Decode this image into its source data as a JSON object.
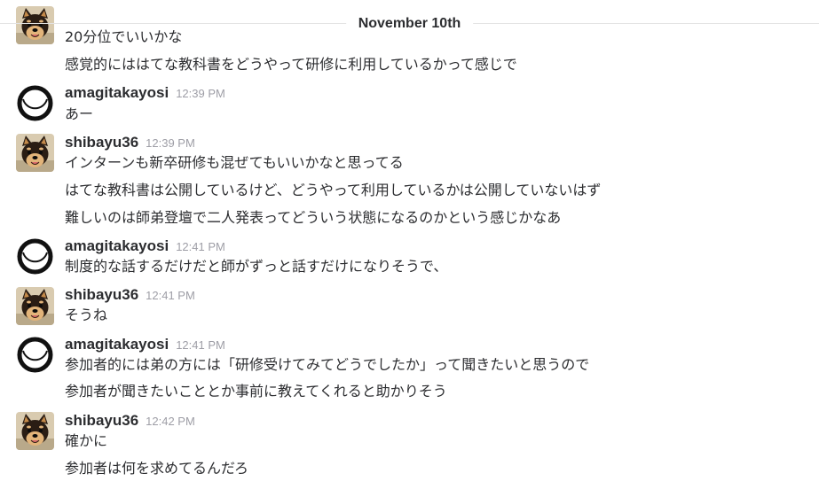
{
  "day_divider": {
    "label": "November 10th"
  },
  "messages": [
    {
      "sender": "",
      "time": "",
      "avatar": "shiba-avatar",
      "lines": [
        "20分位でいいかな",
        "感覚的にははてな教科書をどうやって研修に利用しているかって感じで"
      ]
    },
    {
      "sender": "amagitakayosi",
      "time": "12:39 PM",
      "avatar": "ring-avatar",
      "lines": [
        "あー"
      ]
    },
    {
      "sender": "shibayu36",
      "time": "12:39 PM",
      "avatar": "shiba-avatar",
      "lines": [
        "インターンも新卒研修も混ぜてもいいかなと思ってる",
        "はてな教科書は公開しているけど、どうやって利用しているかは公開していないはず",
        "難しいのは師弟登壇で二人発表ってどういう状態になるのかという感じかなあ"
      ]
    },
    {
      "sender": "amagitakayosi",
      "time": "12:41 PM",
      "avatar": "ring-avatar",
      "lines": [
        "制度的な話するだけだと師がずっと話すだけになりそうで、"
      ]
    },
    {
      "sender": "shibayu36",
      "time": "12:41 PM",
      "avatar": "shiba-avatar",
      "lines": [
        "そうね"
      ]
    },
    {
      "sender": "amagitakayosi",
      "time": "12:41 PM",
      "avatar": "ring-avatar",
      "lines": [
        "参加者的には弟の方には「研修受けてみてどうでしたか」って聞きたいと思うので",
        "参加者が聞きたいこととか事前に教えてくれると助かりそう"
      ]
    },
    {
      "sender": "shibayu36",
      "time": "12:42 PM",
      "avatar": "shiba-avatar",
      "lines": [
        "確かに",
        "参加者は何を求めてるんだろ"
      ]
    }
  ]
}
